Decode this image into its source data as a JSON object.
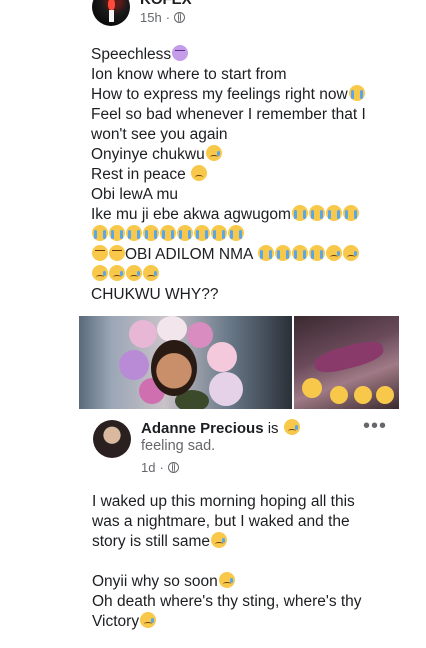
{
  "post": {
    "author": "KOFEX",
    "time": "15h",
    "dot": "·",
    "lines": [
      "Speechless",
      "Ion know where to start from",
      "How to express my feelings right now",
      "Feel so bad whenever I remember that I",
      "won't see you again",
      "Onyinye chukwu",
      "Rest in peace",
      "Obi lewA mu",
      "Ike mu ji ebe akwa agwugom",
      "",
      "OBI ADILOM NMA",
      "",
      "CHUKWU WHY??"
    ]
  },
  "comment": {
    "author": "Adanne Precious",
    "is_text": " is",
    "feeling": "feeling sad.",
    "time": "1d",
    "dot": "·",
    "more": "•••",
    "lines": [
      "I waked up this morning hoping all this",
      "was a nightmare, but I waked and the",
      "story is still same",
      "",
      "Onyii why so soon",
      "Oh death where's thy sting, where's thy",
      "Victory"
    ]
  }
}
